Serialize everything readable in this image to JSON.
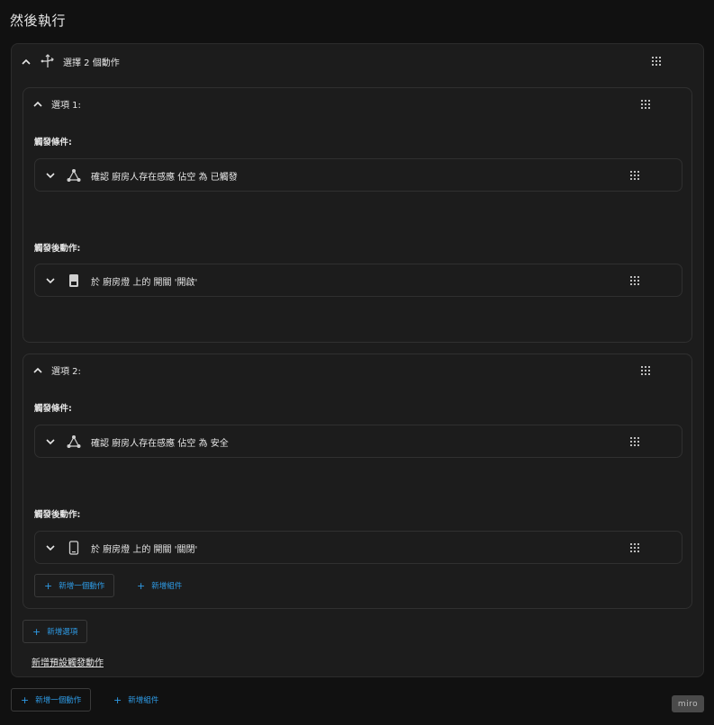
{
  "page": {
    "title": "然後執行"
  },
  "choose": {
    "label": "選擇 2 個動作",
    "options": [
      {
        "label": "選項 1:",
        "conditions_label": "觸發條件:",
        "condition_text": "確認 廚房人存在感應 佔空 為 已觸發",
        "actions_label": "觸發後動作:",
        "action_text": "於 廚房燈 上的 開關 '開啟'"
      },
      {
        "label": "選項 2:",
        "conditions_label": "觸發條件:",
        "condition_text": "確認 廚房人存在感應 佔空 為 安全",
        "actions_label": "觸發後動作:",
        "action_text": "於 廚房燈 上的 開關 '關閉'",
        "add_action_label": "新增一個動作",
        "add_block_label": "新增組件"
      }
    ],
    "add_option_label": "新增選項",
    "add_default_label": "新增預設觸發動作"
  },
  "footer": {
    "add_action_label": "新增一個動作",
    "add_block_label": "新增組件",
    "badge": "miro"
  },
  "colors": {
    "accent": "#2e9be6",
    "background": "#111111",
    "card": "#1c1c1c"
  },
  "icons": [
    "chevron-up-icon",
    "chevron-down-icon",
    "choose-arrows-icon",
    "drag-handle-icon",
    "condition-device-icon",
    "switch-device-icon",
    "phone-device-icon",
    "plus-icon"
  ]
}
